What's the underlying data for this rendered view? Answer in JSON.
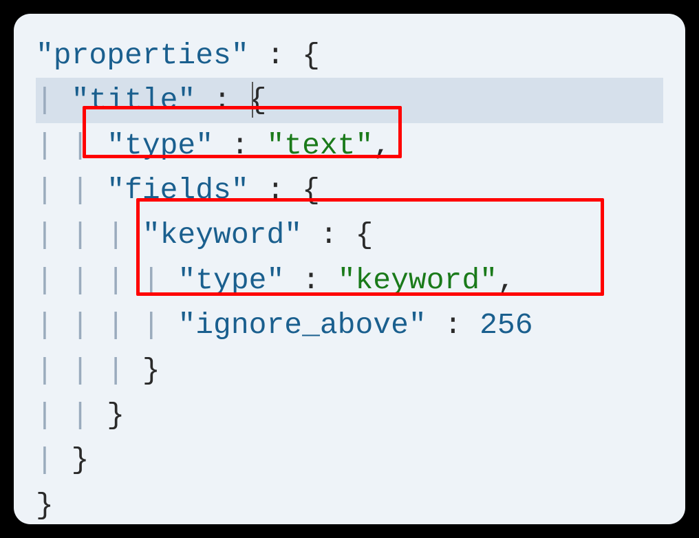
{
  "code": {
    "line1": {
      "key": "\"properties\"",
      "sep": " : ",
      "brace": "{"
    },
    "line2": {
      "indent": "  ",
      "key": "\"title\"",
      "sep": " : ",
      "brace": "{"
    },
    "line3": {
      "indent": "    ",
      "key": "\"type\"",
      "sep": " : ",
      "val": "\"text\"",
      "comma": ","
    },
    "line4": {
      "indent": "    ",
      "key": "\"fields\"",
      "sep": " : ",
      "brace": "{"
    },
    "line5": {
      "indent": "      ",
      "key": "\"keyword\"",
      "sep": " : ",
      "brace": "{"
    },
    "line6": {
      "indent": "        ",
      "key": "\"type\"",
      "sep": " : ",
      "val": "\"keyword\"",
      "comma": ","
    },
    "line7": {
      "indent": "        ",
      "key": "\"ignore_above\"",
      "sep": " : ",
      "val": "256"
    },
    "line8": {
      "indent": "      ",
      "brace": "}"
    },
    "line9": {
      "indent": "    ",
      "brace": "}"
    },
    "line10": {
      "indent": "  ",
      "brace": "}"
    },
    "line11": {
      "indent": "",
      "brace": "}"
    }
  }
}
